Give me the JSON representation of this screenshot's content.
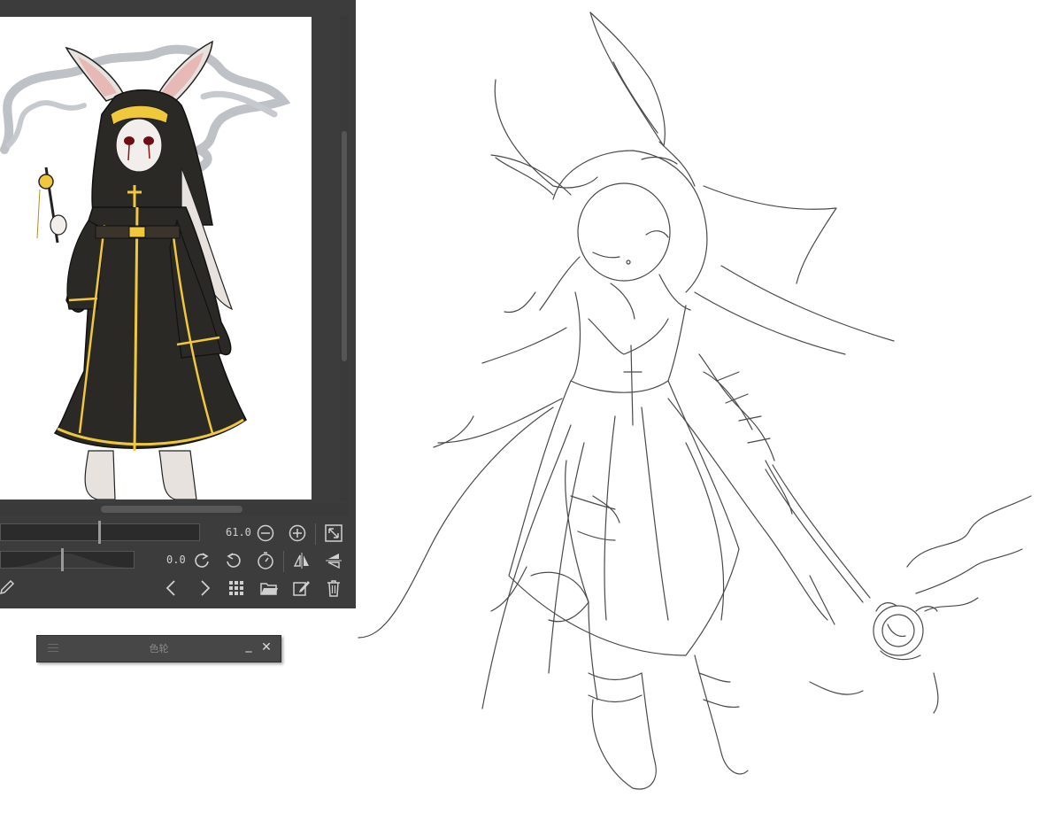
{
  "navigator": {
    "zoom_value": "61.0",
    "rotation_value": "0.0",
    "icons": {
      "zoom_out": "zoom-out-icon",
      "zoom_in": "zoom-in-icon",
      "fit": "fit-to-window-icon",
      "rotate_left": "rotate-left-icon",
      "rotate_right": "rotate-right-icon",
      "reset_rotation": "reset-rotation-icon",
      "flip_horizontal": "flip-horizontal-icon",
      "flip_vertical": "flip-vertical-icon",
      "prev": "chevron-left-icon",
      "next": "chevron-right-icon",
      "grid": "grid-icon",
      "open": "folder-open-icon",
      "edit": "edit-icon",
      "delete": "trash-icon",
      "eyedropper": "eyedropper-icon"
    }
  },
  "color_wheel_panel": {
    "title": "色轮",
    "minimize_label": "_",
    "close_label": "✕"
  },
  "colors": {
    "panel_bg": "#3c3c3c",
    "canvas_bg": "#ffffff",
    "robe": "#2a2926",
    "gold": "#f0c83c"
  }
}
